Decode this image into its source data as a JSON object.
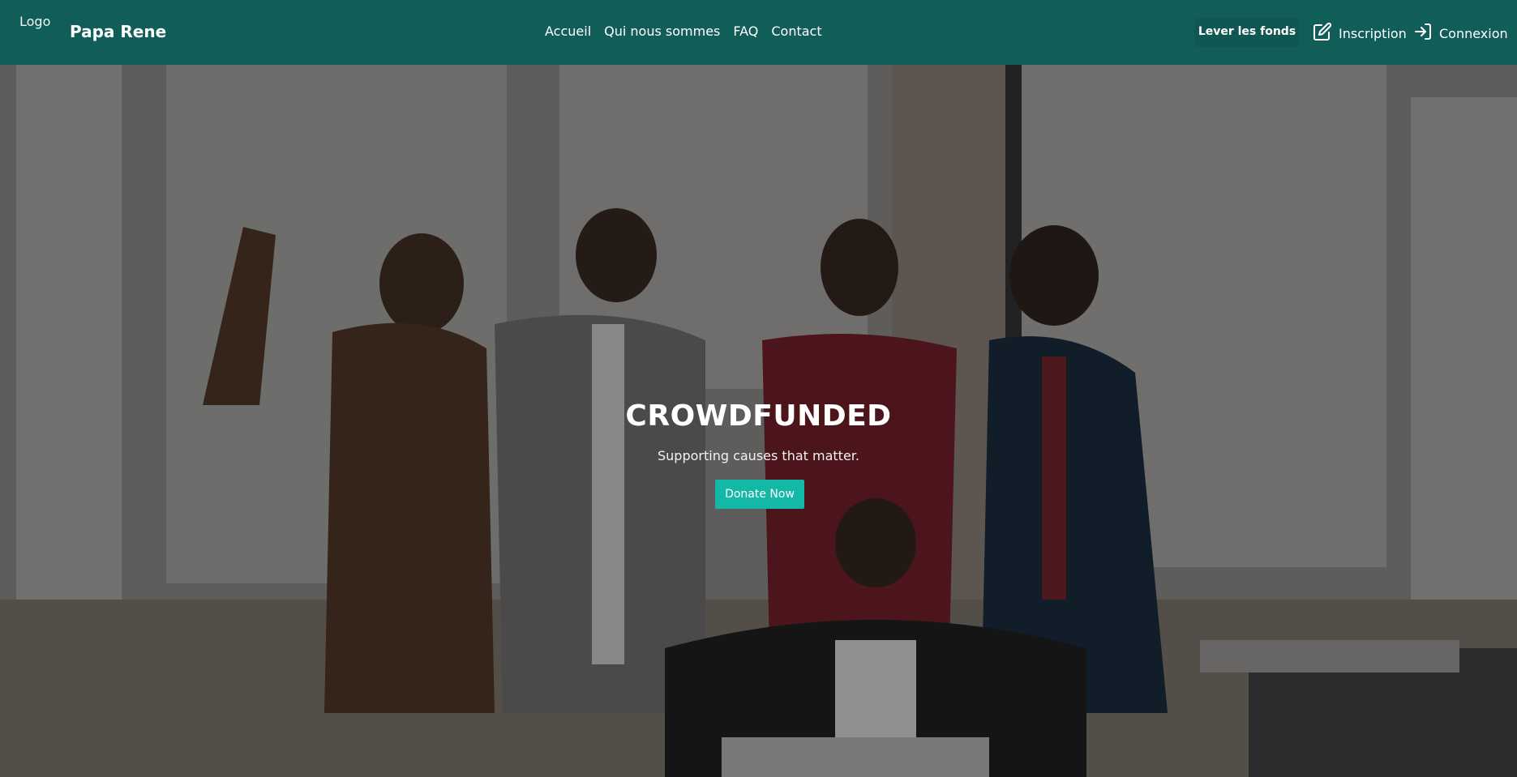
{
  "nav": {
    "logo": "Logo",
    "brand": "Papa Rene",
    "links": [
      "Accueil",
      "Qui nous sommes",
      "FAQ",
      "Contact"
    ],
    "raise_button": "Lever les fonds",
    "register": "Inscription",
    "login": "Connexion",
    "icons": {
      "register": "edit-icon",
      "login": "login-icon"
    }
  },
  "hero": {
    "title": "CROWDFUNDED",
    "subtitle": "Supporting causes that matter.",
    "cta": "Donate Now",
    "image_alt": "team-celebrating-photo"
  },
  "colors": {
    "navbar": "#115e59",
    "accent": "#14b8a6"
  }
}
